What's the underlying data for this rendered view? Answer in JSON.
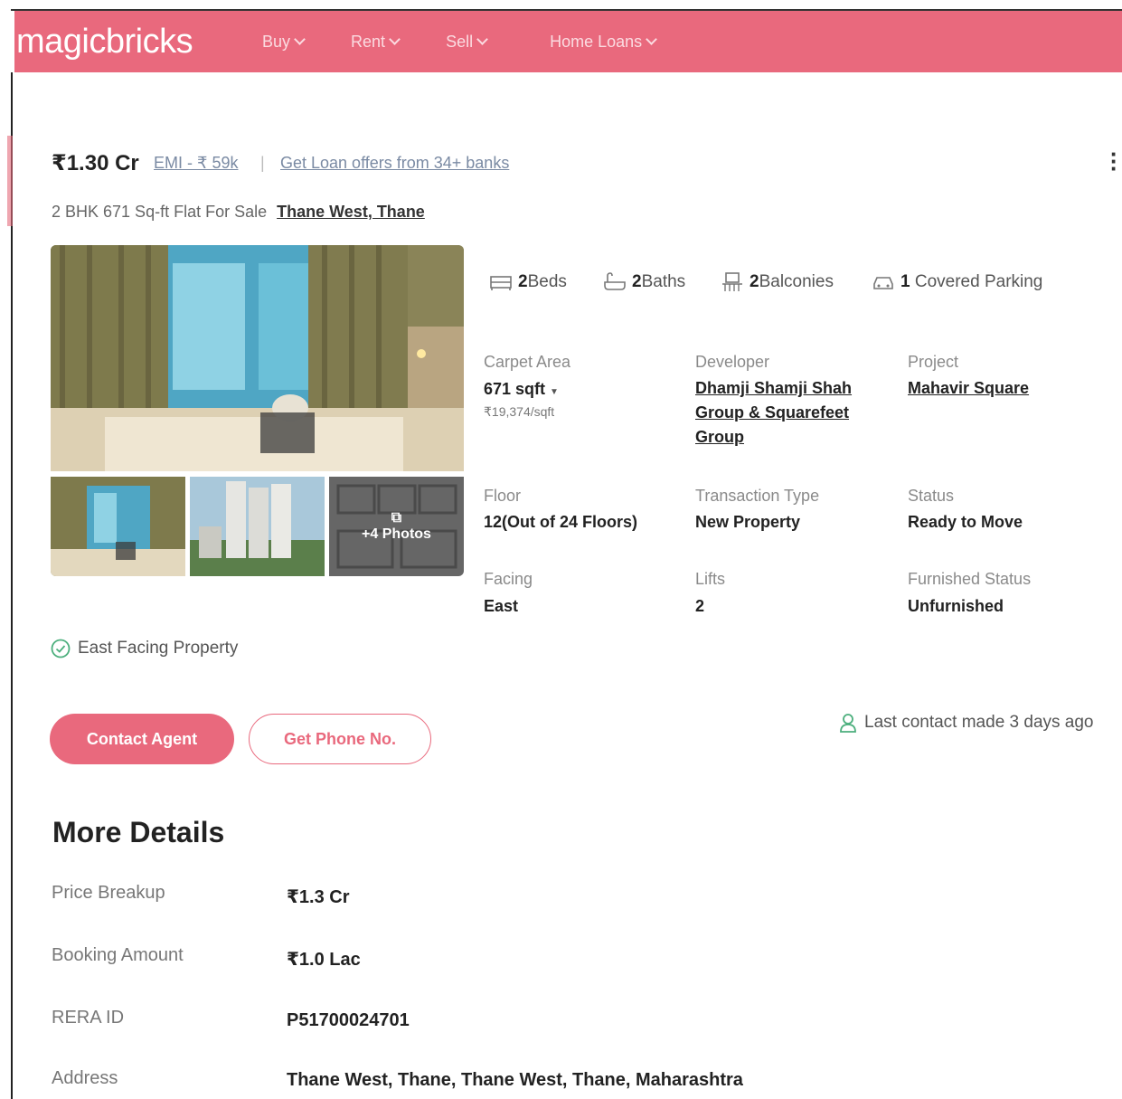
{
  "header": {
    "logo": "magicbricks",
    "nav": [
      {
        "label": "Buy"
      },
      {
        "label": "Rent"
      },
      {
        "label": "Sell"
      },
      {
        "label": "Home Loans"
      }
    ]
  },
  "listing": {
    "price": "₹1.30 Cr",
    "emi": "EMI - ₹ 59k",
    "separator": "|",
    "loan_offer": "Get Loan offers from 34+ banks",
    "subtitle": "2 BHK 671 Sq-ft Flat For Sale",
    "location": "Thane West, Thane",
    "photos_more": "+4 Photos"
  },
  "amenities": {
    "beds_num": "2",
    "beds_label": "Beds",
    "baths_num": "2",
    "baths_label": "Baths",
    "balconies_num": "2",
    "balconies_label": "Balconies",
    "parking_num": "1",
    "parking_label": "Covered Parking"
  },
  "details": {
    "carpet_area_label": "Carpet Area",
    "carpet_area_value": "671 sqft",
    "price_per_sqft": "₹19,374/sqft",
    "developer_label": "Developer",
    "developer_value": "Dhamji Shamji Shah Group & Squarefeet Group",
    "project_label": "Project",
    "project_value": "Mahavir Square",
    "floor_label": "Floor",
    "floor_value": "12(Out of 24 Floors)",
    "transaction_label": "Transaction Type",
    "transaction_value": "New Property",
    "status_label": "Status",
    "status_value": "Ready to Move",
    "facing_label": "Facing",
    "facing_value": "East",
    "lifts_label": "Lifts",
    "lifts_value": "2",
    "furnished_label": "Furnished Status",
    "furnished_value": "Unfurnished"
  },
  "highlight": "East Facing Property",
  "actions": {
    "contact_agent": "Contact Agent",
    "get_phone": "Get Phone No.",
    "last_contact": "Last contact made 3 days ago"
  },
  "more_details": {
    "title": "More Details",
    "rows": [
      {
        "label": "Price Breakup",
        "value": "₹1.3 Cr"
      },
      {
        "label": "Booking Amount",
        "value": "₹1.0 Lac"
      },
      {
        "label": "RERA ID",
        "value": "P51700024701"
      },
      {
        "label": "Address",
        "value": "Thane West, Thane, Thane West, Thane, Maharashtra"
      }
    ]
  },
  "colors": {
    "brand": "#e9697d",
    "link": "#7a8aa3",
    "check_green": "#4caf7d"
  }
}
